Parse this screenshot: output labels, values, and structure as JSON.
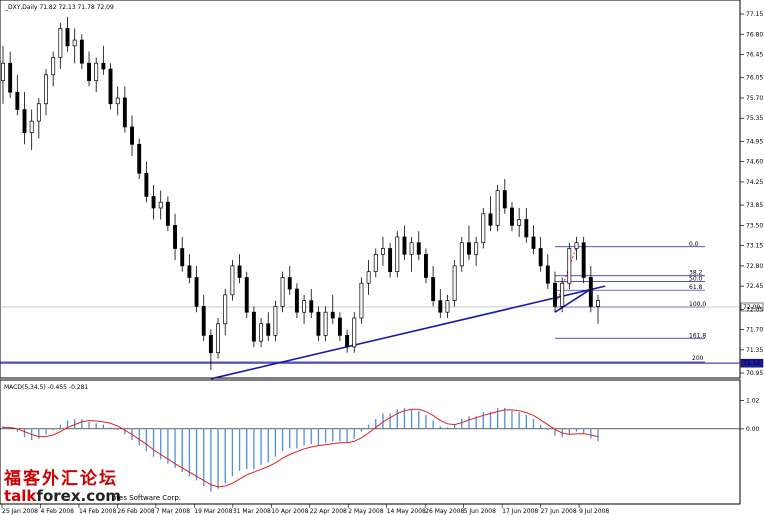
{
  "chart_data": {
    "type": "candlestick",
    "title": "_DXY,Daily  71.82 72.13 71.78 72.09",
    "price_axis": {
      "ticks": [
        "77.15",
        "76.80",
        "76.45",
        "76.05",
        "75.70",
        "75.35",
        "74.95",
        "74.60",
        "74.25",
        "73.85",
        "73.50",
        "73.15",
        "72.80",
        "72.45",
        "72.05",
        "71.70",
        "71.35",
        "70.95"
      ],
      "tick_values": [
        77.15,
        76.8,
        76.45,
        76.05,
        75.7,
        75.35,
        74.95,
        74.6,
        74.25,
        73.85,
        73.5,
        73.15,
        72.8,
        72.45,
        72.05,
        71.7,
        71.35,
        70.95
      ],
      "ylim": [
        70.95,
        77.15
      ]
    },
    "date_axis": {
      "labels": [
        "25 Jan 2008",
        "4 Feb 2008",
        "14 Feb 2008",
        "26 Feb 2008",
        "7 Mar 2008",
        "19 Mar 2008",
        "31 Mar 2008",
        "10 Apr 2008",
        "22 Apr 2008",
        "2 May 2008",
        "14 May 2008",
        "26 May 2008",
        "5 Jun 2008",
        "17 Jun 2008",
        "27 Jun 2008",
        "9 Jul 2008"
      ]
    },
    "candles": [
      [
        76.0,
        76.6,
        75.6,
        76.3
      ],
      [
        76.3,
        76.5,
        75.7,
        75.8
      ],
      [
        75.8,
        76.1,
        75.4,
        75.5
      ],
      [
        75.5,
        75.8,
        74.9,
        75.1
      ],
      [
        75.1,
        75.5,
        74.8,
        75.3
      ],
      [
        75.3,
        75.7,
        75.0,
        75.6
      ],
      [
        75.6,
        76.2,
        75.4,
        76.1
      ],
      [
        76.1,
        76.5,
        75.9,
        76.4
      ],
      [
        76.4,
        77.0,
        76.2,
        76.9
      ],
      [
        76.9,
        77.1,
        76.5,
        76.6
      ],
      [
        76.6,
        76.9,
        76.3,
        76.7
      ],
      [
        76.7,
        76.8,
        76.2,
        76.3
      ],
      [
        76.3,
        76.5,
        75.9,
        76.0
      ],
      [
        76.0,
        76.4,
        75.8,
        76.3
      ],
      [
        76.3,
        76.6,
        76.1,
        76.2
      ],
      [
        76.2,
        76.3,
        75.5,
        75.6
      ],
      [
        75.6,
        75.9,
        75.4,
        75.7
      ],
      [
        75.7,
        75.9,
        75.1,
        75.2
      ],
      [
        75.2,
        75.4,
        74.7,
        74.9
      ],
      [
        74.9,
        75.0,
        74.3,
        74.4
      ],
      [
        74.4,
        74.6,
        73.9,
        74.0
      ],
      [
        74.0,
        74.2,
        73.6,
        73.8
      ],
      [
        73.8,
        74.1,
        73.6,
        73.9
      ],
      [
        73.9,
        74.0,
        73.4,
        73.5
      ],
      [
        73.5,
        73.7,
        72.9,
        73.1
      ],
      [
        73.1,
        73.3,
        72.7,
        72.8
      ],
      [
        72.8,
        73.0,
        72.5,
        72.6
      ],
      [
        72.6,
        72.8,
        72.0,
        72.1
      ],
      [
        72.1,
        72.3,
        71.5,
        71.6
      ],
      [
        71.6,
        71.7,
        71.0,
        71.3
      ],
      [
        71.3,
        71.9,
        71.2,
        71.8
      ],
      [
        71.8,
        72.4,
        71.6,
        72.3
      ],
      [
        72.3,
        72.9,
        72.2,
        72.8
      ],
      [
        72.8,
        73.0,
        72.5,
        72.6
      ],
      [
        72.6,
        72.7,
        71.9,
        72.0
      ],
      [
        72.0,
        72.1,
        71.4,
        71.5
      ],
      [
        71.5,
        71.9,
        71.4,
        71.8
      ],
      [
        71.8,
        72.0,
        71.5,
        71.6
      ],
      [
        71.6,
        72.2,
        71.5,
        72.1
      ],
      [
        72.1,
        72.7,
        72.0,
        72.6
      ],
      [
        72.6,
        72.8,
        72.3,
        72.4
      ],
      [
        72.4,
        72.5,
        71.9,
        72.0
      ],
      [
        72.0,
        72.3,
        71.8,
        72.2
      ],
      [
        72.2,
        72.4,
        71.9,
        72.0
      ],
      [
        72.0,
        72.1,
        71.5,
        71.6
      ],
      [
        71.6,
        72.1,
        71.5,
        72.0
      ],
      [
        72.0,
        72.3,
        71.8,
        71.9
      ],
      [
        71.9,
        72.0,
        71.5,
        71.6
      ],
      [
        71.6,
        71.7,
        71.3,
        71.4
      ],
      [
        71.4,
        72.0,
        71.3,
        71.9
      ],
      [
        71.9,
        72.6,
        71.8,
        72.5
      ],
      [
        72.5,
        72.9,
        72.3,
        72.7
      ],
      [
        72.7,
        73.1,
        72.6,
        73.0
      ],
      [
        73.0,
        73.3,
        72.8,
        73.1
      ],
      [
        73.1,
        73.2,
        72.6,
        72.7
      ],
      [
        72.7,
        73.4,
        72.6,
        73.3
      ],
      [
        73.3,
        73.5,
        72.9,
        73.0
      ],
      [
        73.0,
        73.3,
        72.7,
        73.2
      ],
      [
        73.2,
        73.4,
        72.9,
        73.0
      ],
      [
        73.0,
        73.1,
        72.5,
        72.6
      ],
      [
        72.6,
        72.8,
        72.1,
        72.2
      ],
      [
        72.2,
        72.4,
        71.9,
        72.0
      ],
      [
        72.0,
        72.3,
        71.9,
        72.2
      ],
      [
        72.2,
        72.9,
        72.1,
        72.8
      ],
      [
        72.8,
        73.3,
        72.7,
        73.2
      ],
      [
        73.2,
        73.5,
        72.9,
        73.0
      ],
      [
        73.0,
        73.3,
        72.8,
        73.2
      ],
      [
        73.2,
        73.8,
        73.1,
        73.7
      ],
      [
        73.7,
        74.0,
        73.4,
        73.5
      ],
      [
        73.5,
        74.2,
        73.4,
        74.1
      ],
      [
        74.1,
        74.3,
        73.7,
        73.8
      ],
      [
        73.8,
        73.9,
        73.4,
        73.5
      ],
      [
        73.5,
        73.8,
        73.3,
        73.6
      ],
      [
        73.6,
        73.8,
        73.2,
        73.3
      ],
      [
        73.3,
        73.5,
        73.0,
        73.1
      ],
      [
        73.1,
        73.3,
        72.7,
        72.8
      ],
      [
        72.8,
        73.0,
        72.4,
        72.5
      ],
      [
        72.5,
        72.7,
        72.0,
        72.1
      ],
      [
        72.1,
        72.6,
        72.0,
        72.5
      ],
      [
        72.5,
        73.2,
        72.4,
        73.1
      ],
      [
        73.1,
        73.3,
        72.9,
        73.2
      ],
      [
        73.2,
        73.3,
        72.5,
        72.6
      ],
      [
        72.6,
        72.8,
        72.0,
        72.1
      ],
      [
        72.1,
        72.3,
        71.8,
        72.2
      ]
    ],
    "trendlines": [
      {
        "from": {
          "bar": 29,
          "price": 70.85
        },
        "to": {
          "bar": 84,
          "price": 72.45
        },
        "color": "#1a1aa8"
      },
      {
        "from": {
          "bar": 77,
          "price": 72.0
        },
        "to": {
          "bar": 82,
          "price": 72.4
        },
        "color": "#1a1aa8"
      }
    ],
    "horizontal_lines": [
      {
        "price": 71.12,
        "label": "71.12",
        "color": "#1a1aa8"
      },
      {
        "price": 72.09,
        "label": "72.09",
        "color": "#999999"
      }
    ],
    "fibonacci": {
      "levels": [
        {
          "label": "0.0",
          "price": 73.13
        },
        {
          "label": "38.2",
          "price": 72.63
        },
        {
          "label": "50.0",
          "price": 72.53
        },
        {
          "label": "61.8",
          "price": 72.38
        },
        {
          "label": "100.0",
          "price": 72.09
        },
        {
          "label": "161.8",
          "price": 71.55
        },
        {
          "label": "200",
          "price": 71.14
        }
      ],
      "color": "#1a1aa8"
    },
    "macd": {
      "title": "MACD(5,34,5) -0.455 -0.281",
      "ticks": [
        "1.02",
        "0.00"
      ],
      "tick_values": [
        1.02,
        0.0
      ],
      "ylim": [
        -2.55,
        1.32
      ],
      "histogram": [
        0.1,
        0.05,
        -0.1,
        -0.3,
        -0.4,
        -0.35,
        -0.2,
        -0.05,
        0.15,
        0.3,
        0.35,
        0.35,
        0.25,
        0.2,
        0.15,
        0.05,
        -0.05,
        -0.2,
        -0.4,
        -0.6,
        -0.8,
        -1.0,
        -1.1,
        -1.25,
        -1.4,
        -1.55,
        -1.7,
        -1.85,
        -2.05,
        -2.25,
        -2.15,
        -1.95,
        -1.7,
        -1.5,
        -1.45,
        -1.45,
        -1.3,
        -1.2,
        -1.0,
        -0.8,
        -0.7,
        -0.7,
        -0.6,
        -0.55,
        -0.6,
        -0.5,
        -0.45,
        -0.45,
        -0.5,
        -0.35,
        -0.1,
        0.15,
        0.35,
        0.55,
        0.55,
        0.7,
        0.75,
        0.7,
        0.65,
        0.5,
        0.3,
        0.1,
        0.05,
        0.15,
        0.35,
        0.45,
        0.45,
        0.6,
        0.6,
        0.75,
        0.75,
        0.65,
        0.6,
        0.5,
        0.35,
        0.15,
        -0.05,
        -0.25,
        -0.3,
        -0.2,
        -0.1,
        -0.15,
        -0.35,
        -0.45
      ],
      "signal": [
        0.05,
        0.05,
        0.0,
        -0.1,
        -0.2,
        -0.28,
        -0.28,
        -0.22,
        -0.1,
        0.05,
        0.15,
        0.25,
        0.3,
        0.28,
        0.25,
        0.2,
        0.1,
        -0.05,
        -0.2,
        -0.38,
        -0.55,
        -0.75,
        -0.92,
        -1.08,
        -1.25,
        -1.4,
        -1.55,
        -1.7,
        -1.85,
        -2.0,
        -2.08,
        -2.05,
        -1.95,
        -1.8,
        -1.65,
        -1.55,
        -1.45,
        -1.35,
        -1.22,
        -1.05,
        -0.92,
        -0.82,
        -0.72,
        -0.65,
        -0.6,
        -0.57,
        -0.53,
        -0.5,
        -0.5,
        -0.45,
        -0.32,
        -0.15,
        0.05,
        0.25,
        0.4,
        0.55,
        0.65,
        0.7,
        0.7,
        0.62,
        0.48,
        0.3,
        0.18,
        0.15,
        0.22,
        0.32,
        0.4,
        0.48,
        0.55,
        0.62,
        0.68,
        0.68,
        0.65,
        0.58,
        0.48,
        0.32,
        0.15,
        -0.02,
        -0.15,
        -0.2,
        -0.18,
        -0.17,
        -0.22,
        -0.28
      ]
    }
  },
  "watermark": {
    "cn": "福客外汇论坛",
    "en_prefix": "talk",
    "en_suffix": "forex.com",
    "partial_text": "otes Software Corp."
  }
}
